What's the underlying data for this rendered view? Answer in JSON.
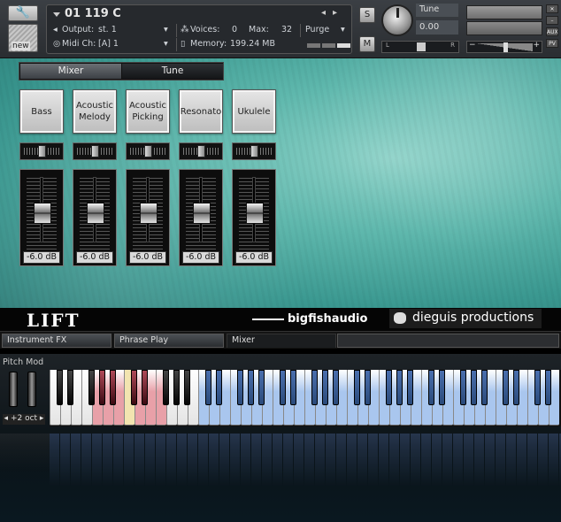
{
  "header": {
    "wrench_icon": "wrench-icon",
    "new_label": "new",
    "instrument_name": "01 119 C",
    "output_label": "Output:",
    "output_value": "st. 1",
    "voices_label": "Voices:",
    "voices_value": "0",
    "max_label": "Max:",
    "max_value": "32",
    "purge_label": "Purge",
    "midi_label": "Midi Ch:",
    "midi_value": "[A]  1",
    "memory_label": "Memory:",
    "memory_value": "199.24 MB",
    "solo_label": "S",
    "mute_label": "M",
    "tune_label": "Tune",
    "tune_value": "0.00",
    "pan_left": "L",
    "pan_right": "R",
    "side_aux": "AUX",
    "side_pv": "PV"
  },
  "tabs": {
    "mixer": "Mixer",
    "tune": "Tune"
  },
  "channels": [
    {
      "name": "Bass",
      "db": "-6.0 dB",
      "level": 0.5
    },
    {
      "name": "Acoustic Melody",
      "db": "-6.0 dB",
      "level": 0.5
    },
    {
      "name": "Acoustic Picking",
      "db": "-6.0 dB",
      "level": 0.5
    },
    {
      "name": "Resonato",
      "db": "-6.0 dB",
      "level": 0.5
    },
    {
      "name": "Ukulele",
      "db": "-6.0 dB",
      "level": 0.5
    }
  ],
  "brand": {
    "lift": "LIFT",
    "bigfish": "bigfishaudio",
    "dieguis": "dieguis productions"
  },
  "subtabs": {
    "instrument_fx": "Instrument FX",
    "phrase_play": "Phrase Play",
    "mixer": "Mixer"
  },
  "keyboard": {
    "pitch_mod_label": "Pitch Mod",
    "octave_label": "+2 oct",
    "colors": {
      "red": "#e8a0a8",
      "yellow": "#f2e4b0",
      "blue": "#a9c6ee",
      "blue_black": "#2a4a7a"
    }
  }
}
